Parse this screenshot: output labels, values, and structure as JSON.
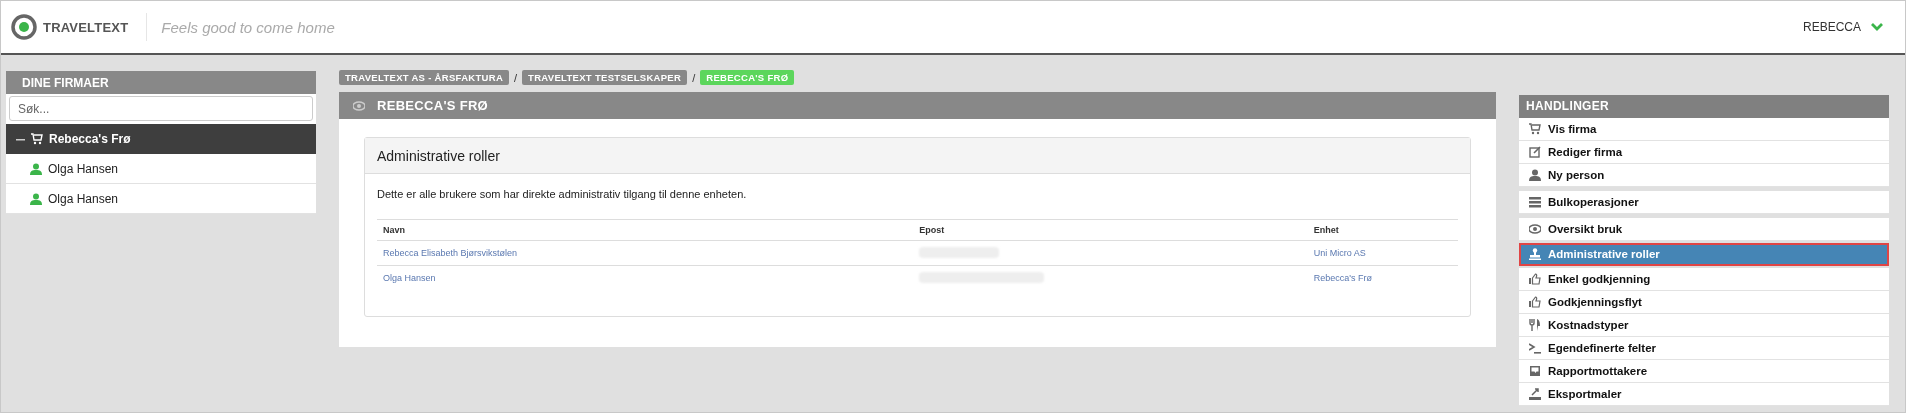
{
  "header": {
    "logo": "TRAVELTEXT",
    "tagline": "Feels good to come home",
    "user": "REBECCA"
  },
  "sidebar": {
    "title": "DINE FIRMAER",
    "search": {
      "placeholder": "Søk..."
    },
    "tree": [
      {
        "label": "Rebecca's Frø",
        "selected": true,
        "expanded": true,
        "children": [
          {
            "label": "Olga Hansen",
            "selected": false
          },
          {
            "label": "Olga Hansen",
            "selected": false
          }
        ]
      }
    ]
  },
  "breadcrumb_separator": "/",
  "breadcrumbs": [
    {
      "label": "TRAVELTEXT AS - ÅRSFAKTURA",
      "selected": false
    },
    {
      "label": "TRAVELTEXT TESTSELSKAPER",
      "selected": false
    },
    {
      "label": "REBECCA'S FRØ",
      "selected": true
    }
  ],
  "panel": {
    "title": "REBECCA'S FRØ",
    "card": {
      "title": "Administrative roller",
      "description": "Dette er alle brukere som har direkte administrativ tilgang til denne enheten.",
      "columns": [
        "Navn",
        "Epost",
        "Enhet"
      ],
      "rows": [
        {
          "name": "Rebecca Elisabeth Bjørsvikstølen",
          "email_redacted": true,
          "unit": "Uni Micro AS"
        },
        {
          "name": "Olga Hansen",
          "email_redacted": true,
          "unit": "Rebecca's Frø"
        }
      ]
    }
  },
  "actions": {
    "title": "HANDLINGER",
    "groups": [
      {
        "items": [
          {
            "label": "Vis firma",
            "kind": "cart",
            "selected": false
          },
          {
            "label": "Rediger firma",
            "kind": "edit",
            "selected": false
          },
          {
            "label": "Ny person",
            "kind": "person",
            "selected": false
          }
        ]
      },
      {
        "items": [
          {
            "label": "Bulkoperasjoner",
            "kind": "list",
            "selected": false
          }
        ]
      },
      {
        "items": [
          {
            "label": "Oversikt bruk",
            "kind": "eye",
            "selected": false
          },
          {
            "label": "Administrative roller",
            "kind": "stamp",
            "selected": true
          },
          {
            "label": "Enkel godkjenning",
            "kind": "thumb",
            "selected": false
          },
          {
            "label": "Godkjenningsflyt",
            "kind": "thumb",
            "selected": false
          },
          {
            "label": "Kostnadstyper",
            "kind": "cutlery",
            "selected": false
          },
          {
            "label": "Egendefinerte felter",
            "kind": "prompt",
            "selected": false
          },
          {
            "label": "Rapportmottakere",
            "kind": "inbox",
            "selected": false
          },
          {
            "label": "Eksportmaler",
            "kind": "export",
            "selected": false
          }
        ]
      }
    ]
  }
}
